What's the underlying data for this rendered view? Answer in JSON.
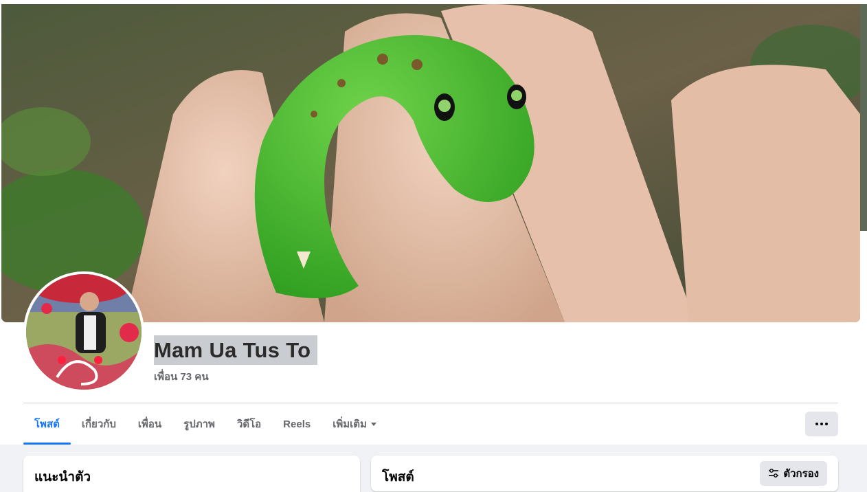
{
  "profile": {
    "name": "Mam Ua Tus To",
    "friends_text": "เพื่อน 73 คน"
  },
  "tabs": [
    {
      "label": "โพสต์",
      "active": true
    },
    {
      "label": "เกี่ยวกับ",
      "active": false
    },
    {
      "label": "เพื่อน",
      "active": false
    },
    {
      "label": "รูปภาพ",
      "active": false
    },
    {
      "label": "วิดีโอ",
      "active": false
    },
    {
      "label": "Reels",
      "active": false
    },
    {
      "label": "เพิ่มเติม",
      "active": false
    }
  ],
  "intro_card": {
    "title": "แนะนำตัว"
  },
  "posts_card": {
    "title": "โพสต์",
    "filter_label": "ตัวกรอง"
  },
  "icons": {
    "more": "more-horizontal-icon",
    "filter": "sliders-icon",
    "dropdown": "chevron-down-icon"
  },
  "colors": {
    "accent": "#1877f2",
    "background": "#f0f2f5",
    "button": "#e4e6eb"
  }
}
